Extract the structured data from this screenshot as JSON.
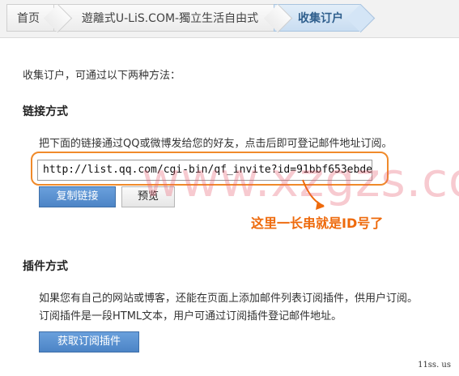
{
  "breadcrumb": {
    "home": "首页",
    "site": "遊離式U-LiS.COM-獨立生活自由式",
    "current": "收集订户"
  },
  "intro": "收集订户，可通过以下两种方法：",
  "link_section": {
    "title": "链接方式",
    "description": "把下面的链接通过QQ或微博发给您的好友，点击后即可登记邮件地址订阅。",
    "url_value": "http://list.qq.com/cgi-bin/qf_invite?id=91bbf653ebde",
    "copy_button": "复制链接",
    "preview_button": "预览"
  },
  "annotation": "这里一长串就是ID号了",
  "plugin_section": {
    "title": "插件方式",
    "description_line1": "如果您有自己的网站或博客，还能在页面上添加邮件列表订阅插件，供用户订阅。",
    "description_line2": "订阅插件是一段HTML文本，用户可通过订阅插件登记邮件地址。",
    "get_plugin_button": "获取订阅插件"
  },
  "watermark": "www.xzgzs.com",
  "footer_mark": "11ss. us",
  "colors": {
    "annotation": "#ee6a0c",
    "primary_button": "#4c84c6",
    "active_crumb": "#c9ddf1"
  }
}
